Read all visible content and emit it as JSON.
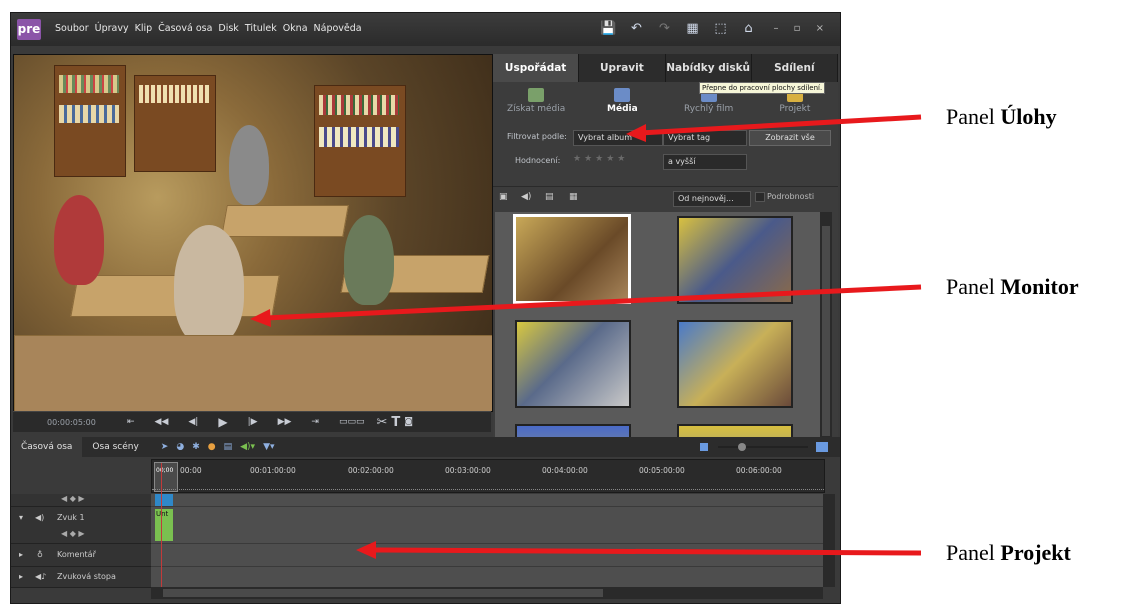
{
  "app": {
    "logo": "pre",
    "menu": [
      "Soubor",
      "Úpravy",
      "Klip",
      "Časová osa",
      "Disk",
      "Titulek",
      "Okna",
      "Nápověda"
    ],
    "window_controls": "– ▫ ×"
  },
  "monitor": {
    "timecode": "00:00:05:00"
  },
  "tasks": {
    "tabs": [
      "Uspořádat",
      "Upravit",
      "Nabídky disků",
      "Sdílení"
    ],
    "tooltip": "Přepne do pracovní plochy sdílení.",
    "subtabs": [
      "Získat média",
      "Média",
      "Rychlý film",
      "Projekt"
    ],
    "filter_label": "Filtrovat podle:",
    "album_dd": "Vybrat album",
    "tag_dd": "Vybrat tag",
    "show_all": "Zobrazit vše",
    "rating_label": "Hodnocení:",
    "rating_dd": "a vyšší",
    "sort_dd": "Od nejnověj...",
    "details_label": "Podrobnosti"
  },
  "timeline": {
    "tabs": [
      "Časová osa",
      "Osa scény"
    ],
    "ruler": [
      "00:00",
      "00:01:00:00",
      "00:02:00:00",
      "00:03:00:00",
      "00:04:00:00",
      "00:05:00:00",
      "00:06:00:00"
    ],
    "cti_label": "00;00",
    "tracks": {
      "audio1": "Zvuk 1",
      "narration": "Komentář",
      "soundtrack": "Zvuková stopa"
    },
    "clip_label": "Unt"
  },
  "annotations": {
    "prefix": "Panel",
    "tasks_panel": "Úlohy",
    "monitor_panel": "Monitor",
    "project_panel": "Projekt"
  },
  "colors": {
    "arrow": "#e8191c",
    "accent": "#2f88c8"
  }
}
